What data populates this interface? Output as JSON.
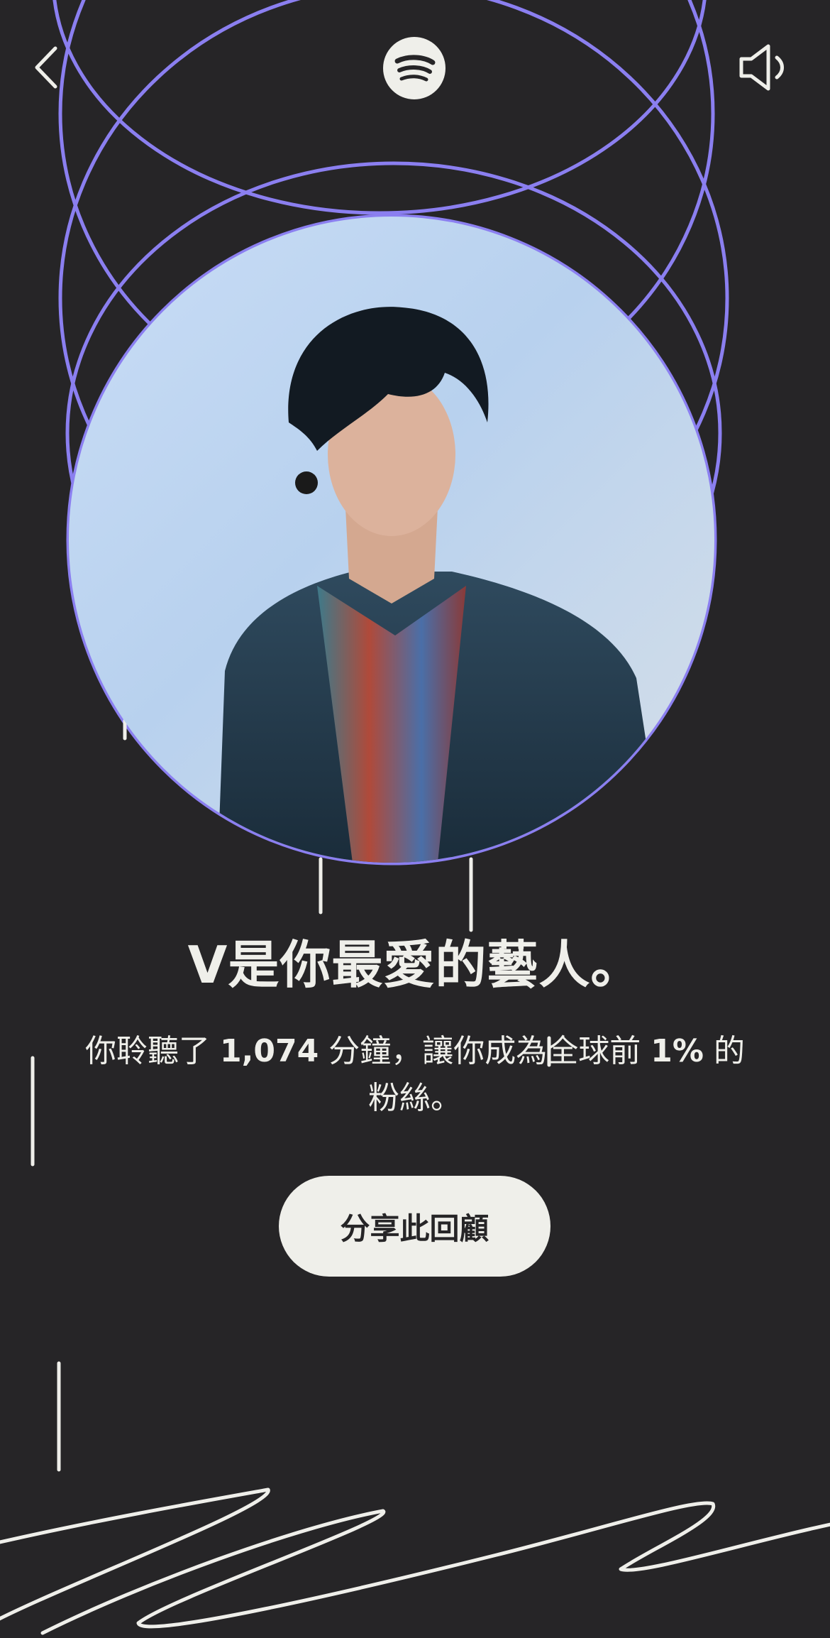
{
  "colors": {
    "background": "#262527",
    "accent_ring": "#8b7ff0",
    "foreground": "#efefea"
  },
  "header": {
    "back_icon": "chevron-left-icon",
    "logo_icon": "spotify-logo-icon",
    "sound_icon": "speaker-icon"
  },
  "headline": {
    "artist": "V",
    "rest": "是你最愛的藝人。"
  },
  "stat": {
    "prefix": "你聆聽了",
    "minutes": "1,074",
    "middle": "分鐘，讓你成為全球前",
    "percent": "1%",
    "suffix": "的粉絲。"
  },
  "share_button": {
    "label": "分享此回顧"
  }
}
